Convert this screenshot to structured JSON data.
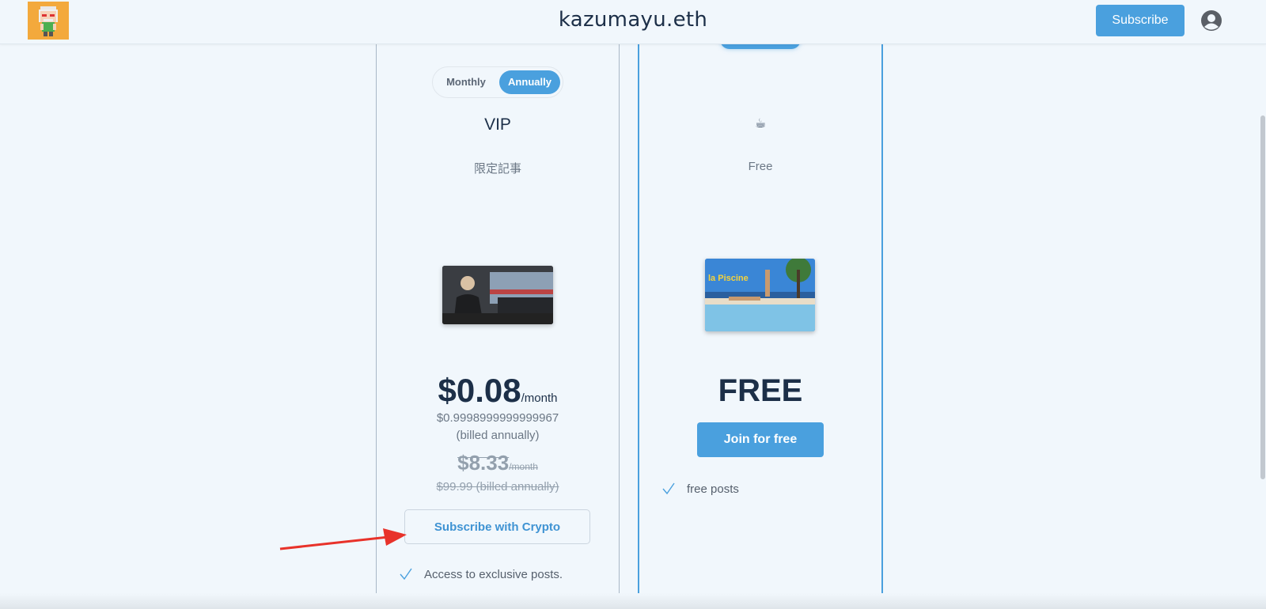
{
  "header": {
    "site_title": "kazumayu.eth",
    "subscribe_label": "Subscribe",
    "account_icon": "account-circle-icon"
  },
  "billing_toggle": {
    "monthly_label": "Monthly",
    "annually_label": "Annually",
    "selected": "Annually"
  },
  "tiers": [
    {
      "name": "VIP",
      "description": "限定記事",
      "price": "$0.08",
      "price_unit": "/month",
      "billed_amount": "$0.9998999999999967",
      "billed_note": "(billed annually)",
      "original_price": "$8.33",
      "original_unit": "/month",
      "original_billed": "$99.99 (billed annually)",
      "cta_label": "Subscribe with Crypto",
      "features": [
        "Access to exclusive posts."
      ]
    },
    {
      "name": "☕",
      "description": "Free",
      "price": "FREE",
      "cta_label": "Join for free",
      "features": [
        "free posts"
      ]
    }
  ],
  "colors": {
    "accent": "#4aa0de",
    "background": "#f1f7fc",
    "heading": "#1c2f48",
    "annotation_arrow": "#e8322a"
  }
}
